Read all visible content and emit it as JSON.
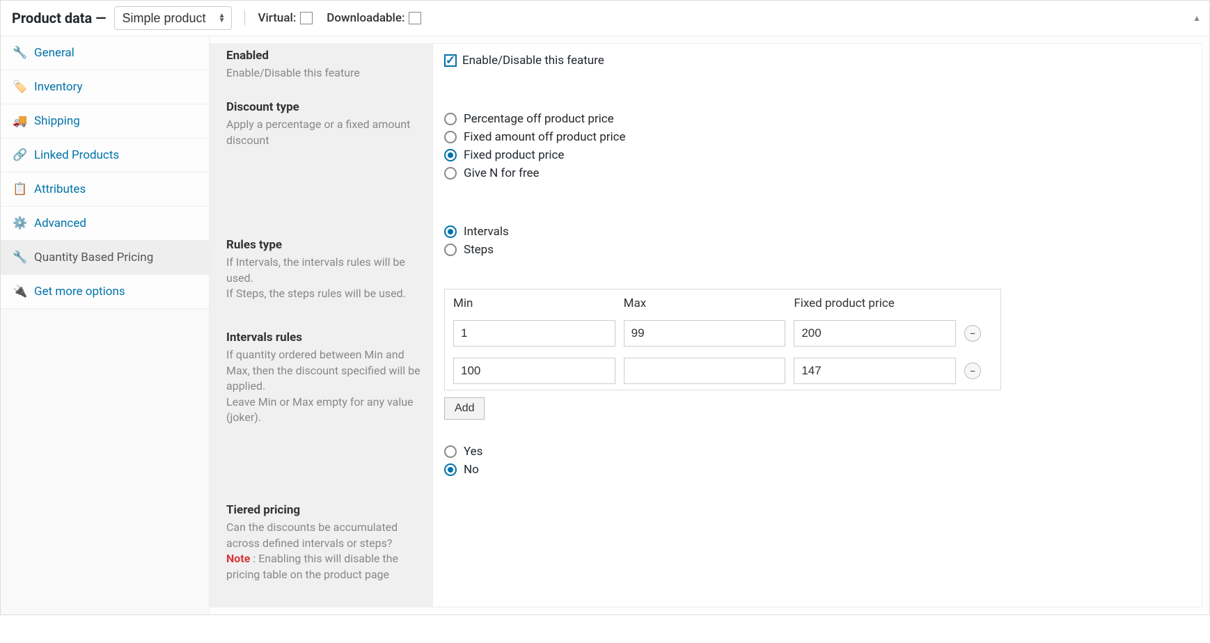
{
  "header": {
    "title": "Product data —",
    "product_type": "Simple product",
    "virtual_label": "Virtual:",
    "downloadable_label": "Downloadable:"
  },
  "sidebar": {
    "items": [
      {
        "label": "General",
        "icon": "wrench"
      },
      {
        "label": "Inventory",
        "icon": "tag"
      },
      {
        "label": "Shipping",
        "icon": "truck"
      },
      {
        "label": "Linked Products",
        "icon": "link"
      },
      {
        "label": "Attributes",
        "icon": "list"
      },
      {
        "label": "Advanced",
        "icon": "gear"
      },
      {
        "label": "Quantity Based Pricing",
        "icon": "wrench2",
        "active": true
      },
      {
        "label": "Get more options",
        "icon": "plug"
      }
    ]
  },
  "settings": {
    "enabled": {
      "title": "Enabled",
      "desc": "Enable/Disable this feature",
      "checkbox_label": "Enable/Disable this feature",
      "checked": true
    },
    "discount_type": {
      "title": "Discount type",
      "desc": "Apply a percentage or a fixed amount discount",
      "options": [
        "Percentage off product price",
        "Fixed amount off product price",
        "Fixed product price",
        "Give N for free"
      ],
      "selected": 2
    },
    "rules_type": {
      "title": "Rules type",
      "desc": "If Intervals, the intervals rules will be used.\nIf Steps, the steps rules will be used.",
      "options": [
        "Intervals",
        "Steps"
      ],
      "selected": 0
    },
    "intervals_rules": {
      "title": "Intervals rules",
      "desc": "If quantity ordered between Min and Max, then the discount specified will be applied.\nLeave Min or Max empty for any value (joker).",
      "headers": [
        "Min",
        "Max",
        "Fixed product price"
      ],
      "rows": [
        {
          "min": "1",
          "max": "99",
          "price": "200"
        },
        {
          "min": "100",
          "max": "",
          "price": "147"
        }
      ],
      "add_label": "Add"
    },
    "tiered": {
      "title": "Tiered pricing",
      "desc_pre": "Can the discounts be accumulated across defined intervals or steps?",
      "note_label": "Note",
      "desc_post": " : Enabling this will disable the pricing table on the product page",
      "options": [
        "Yes",
        "No"
      ],
      "selected": 1
    }
  }
}
